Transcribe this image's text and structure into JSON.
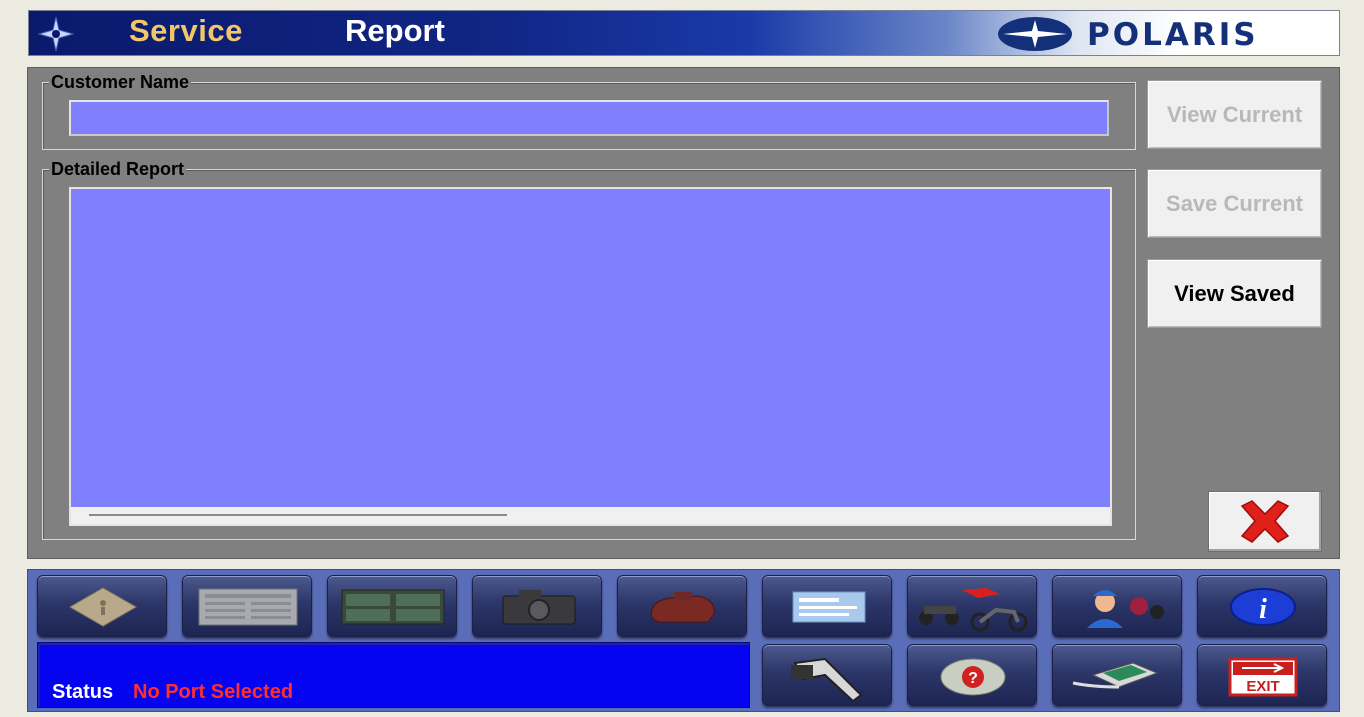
{
  "title": {
    "word1": "Service",
    "word2": "Report",
    "logo": "POLARIS"
  },
  "customer": {
    "label": "Customer Name",
    "value": ""
  },
  "report": {
    "label": "Detailed Report",
    "value": ""
  },
  "side_buttons": {
    "view_current": "View Current",
    "save_current": "Save Current",
    "view_saved": "View Saved"
  },
  "status": {
    "label": "Status",
    "value": "No Port Selected"
  },
  "toolbar_icons": [
    "diagnostic-diamond-icon",
    "data-sheet-icon",
    "gauge-display-icon",
    "camera-icon",
    "engine-icon",
    "report-card-icon",
    "vehicles-icon",
    "technician-icon",
    "info-icon",
    "wrench-icon",
    "help-icon",
    "interface-device-icon",
    "exit-icon"
  ],
  "colors": {
    "field_bg": "#8080ff",
    "panel_bg": "#808080",
    "status_bg": "#0404f0",
    "status_value": "#ff2f2f"
  }
}
